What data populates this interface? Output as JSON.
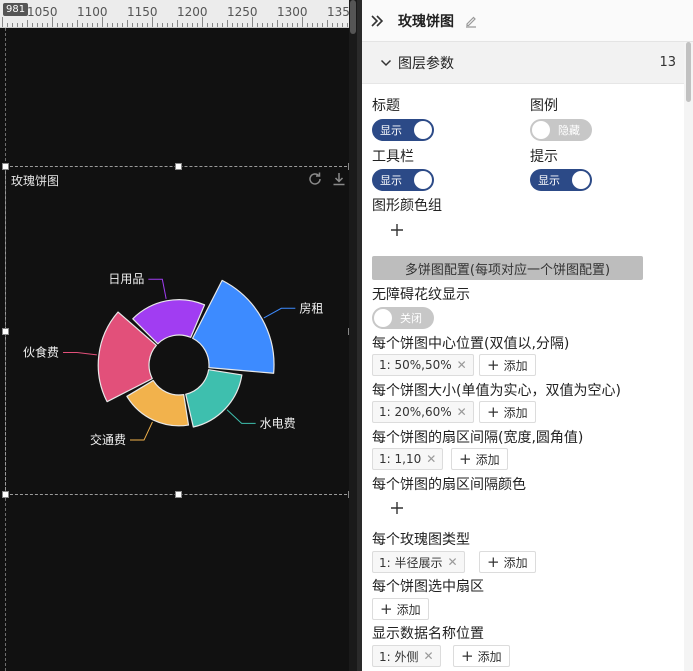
{
  "canvas": {
    "ruler_badge": "981",
    "ruler_labels": [
      "1050",
      "1100",
      "1150",
      "1200",
      "1250",
      "1300",
      "1350"
    ],
    "widget_title": "玫瑰饼图",
    "tools": [
      "refresh-icon",
      "download-icon"
    ]
  },
  "chart_data": {
    "type": "pie",
    "variant": "rose-radius",
    "title": "玫瑰饼图",
    "categories": [
      "房租",
      "水电费",
      "交通费",
      "伙食费",
      "日用品"
    ],
    "values": [
      100,
      45,
      40,
      75,
      48
    ],
    "colors": [
      "#3d8bff",
      "#3ebfae",
      "#f2b24c",
      "#e2507a",
      "#a13df2"
    ],
    "label_position": "outside"
  },
  "panel": {
    "title": "玫瑰饼图",
    "section_title": "图层参数",
    "section_count": "13",
    "labels": {
      "title": "标题",
      "legend": "图例",
      "toolbar": "工具栏",
      "tooltip": "提示",
      "color_group": "图形颜色组",
      "multi_config": "多饼图配置(每项对应一个饼图配置)",
      "a11y_pattern": "无障碍花纹显示",
      "center": "每个饼图中心位置(双值以,分隔)",
      "size": "每个饼图大小(单值为实心，双值为空心)",
      "gap": "每个饼图的扇区间隔(宽度,圆角值)",
      "gap_color": "每个饼图的扇区间隔颜色",
      "rose_type": "每个玫瑰图类型",
      "selected": "每个饼图选中扇区",
      "label_pos": "显示数据名称位置"
    },
    "toggles": {
      "title": "显示",
      "legend": "隐藏",
      "toolbar": "显示",
      "tooltip": "显示",
      "a11y": "关闭"
    },
    "tags": {
      "center": "1: 50%,50%",
      "size": "1: 20%,60%",
      "gap": "1: 1,10",
      "rose_type": "1: 半径展示",
      "label_pos": "1: 外侧"
    },
    "add_label": "添加"
  }
}
